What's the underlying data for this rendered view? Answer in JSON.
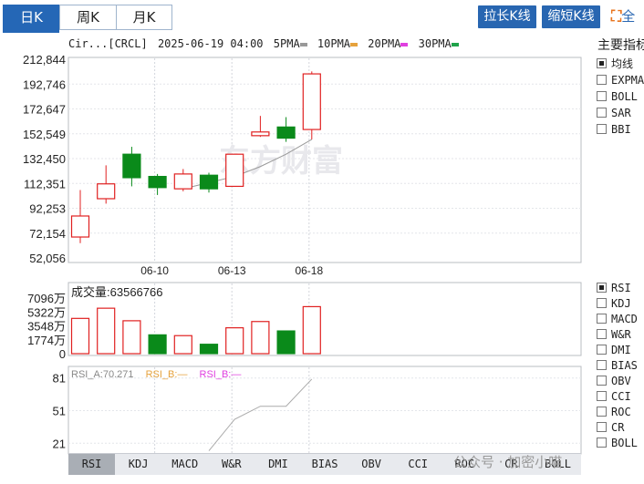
{
  "period_tabs": [
    {
      "label": "日K",
      "active": true
    },
    {
      "label": "周K",
      "active": false
    },
    {
      "label": "月K",
      "active": false
    }
  ],
  "toolbar": {
    "stretch_label": "拉长K线",
    "shrink_label": "缩短K线",
    "fullscreen_label": "全",
    "fullscreen_icon": "expand-icon"
  },
  "kline_info": {
    "stock": "Cir...[CRCL]",
    "datetime": "2025-06-19 04:00",
    "ma": [
      {
        "label": "5PMA",
        "color": "#999999"
      },
      {
        "label": "10PMA",
        "color": "#e6a23c"
      },
      {
        "label": "20PMA",
        "color": "#e040e0"
      },
      {
        "label": "30PMA",
        "color": "#1fa34a"
      }
    ]
  },
  "watermark_logo": "东方财富",
  "volume_panel": {
    "label": "成交量",
    "value": "63566766"
  },
  "rsi_panel": {
    "rsi_a_label": "RSI_A:",
    "rsi_a_value": "70.271",
    "rsi_b_label": "RSI_B:",
    "rsi_b_value": "—",
    "rsi_c_label": "RSI_B:",
    "rsi_c_value": "—"
  },
  "main_indicators": {
    "title": "主要指标",
    "items": [
      {
        "label": "均线",
        "checked": true
      },
      {
        "label": "EXPMA",
        "checked": false
      },
      {
        "label": "BOLL",
        "checked": false
      },
      {
        "label": "SAR",
        "checked": false
      },
      {
        "label": "BBI",
        "checked": false
      }
    ]
  },
  "sub_indicators": {
    "items": [
      {
        "label": "RSI",
        "checked": true
      },
      {
        "label": "KDJ",
        "checked": false
      },
      {
        "label": "MACD",
        "checked": false
      },
      {
        "label": "W&R",
        "checked": false
      },
      {
        "label": "DMI",
        "checked": false
      },
      {
        "label": "BIAS",
        "checked": false
      },
      {
        "label": "OBV",
        "checked": false
      },
      {
        "label": "CCI",
        "checked": false
      },
      {
        "label": "ROC",
        "checked": false
      },
      {
        "label": "CR",
        "checked": false
      },
      {
        "label": "BOLL",
        "checked": false
      }
    ]
  },
  "bottom_tabs": [
    {
      "label": "RSI",
      "active": true
    },
    {
      "label": "KDJ",
      "active": false
    },
    {
      "label": "MACD",
      "active": false
    },
    {
      "label": "W&R",
      "active": false
    },
    {
      "label": "DMI",
      "active": false
    },
    {
      "label": "BIAS",
      "active": false
    },
    {
      "label": "OBV",
      "active": false
    },
    {
      "label": "CCI",
      "active": false
    },
    {
      "label": "ROC",
      "active": false
    },
    {
      "label": "CR",
      "active": false
    },
    {
      "label": "BOLL",
      "active": false
    }
  ],
  "watermark_text": "公众号 · 加密小喵",
  "colors": {
    "up": "#e02020",
    "down": "#0a8a1a",
    "accent": "#2567b6"
  },
  "chart_data": [
    {
      "type": "candlestick",
      "name": "price",
      "y_ticks": [
        "212,844",
        "192,746",
        "172,647",
        "152,549",
        "132,450",
        "112,351",
        "92,253",
        "72,154",
        "52,056"
      ],
      "ylim": [
        52.056,
        212.844
      ],
      "x_tick_labels": [
        {
          "label": "06-10",
          "index": 3
        },
        {
          "label": "06-13",
          "index": 6
        },
        {
          "label": "06-18",
          "index": 9
        }
      ],
      "candles": [
        {
          "open": 69,
          "close": 86,
          "high": 107,
          "low": 64,
          "up": true
        },
        {
          "open": 100,
          "close": 112,
          "high": 127,
          "low": 96,
          "up": true
        },
        {
          "open": 136,
          "close": 117,
          "high": 142,
          "low": 110,
          "up": false
        },
        {
          "open": 118,
          "close": 109,
          "high": 120,
          "low": 103,
          "up": false
        },
        {
          "open": 108,
          "close": 120,
          "high": 124,
          "low": 106,
          "up": true
        },
        {
          "open": 119,
          "close": 108,
          "high": 121,
          "low": 105,
          "up": false
        },
        {
          "open": 110,
          "close": 136,
          "high": 136,
          "low": 110,
          "up": true
        },
        {
          "open": 151,
          "close": 154,
          "high": 167,
          "low": 150,
          "up": true
        },
        {
          "open": 158,
          "close": 149,
          "high": 166,
          "low": 146,
          "up": false
        },
        {
          "open": 156,
          "close": 201,
          "high": 203,
          "low": 148,
          "up": true
        }
      ],
      "ma5": [
        null,
        null,
        null,
        null,
        108,
        113,
        118,
        126,
        136,
        148
      ]
    },
    {
      "type": "bar",
      "name": "volume",
      "y_ticks": [
        "7096万",
        "5322万",
        "3548万",
        "1774万",
        "0"
      ],
      "ylim": [
        0,
        7096
      ],
      "values": [
        4500,
        5800,
        4200,
        2400,
        2300,
        1200,
        3300,
        4100,
        2900,
        6000
      ],
      "up": [
        true,
        true,
        true,
        false,
        true,
        false,
        true,
        true,
        false,
        true
      ]
    },
    {
      "type": "line",
      "name": "rsi",
      "y_ticks": [
        "81",
        "51",
        "21"
      ],
      "ylim": [
        12,
        90
      ],
      "values": [
        null,
        null,
        null,
        null,
        null,
        14,
        43,
        55,
        55,
        80
      ]
    }
  ]
}
